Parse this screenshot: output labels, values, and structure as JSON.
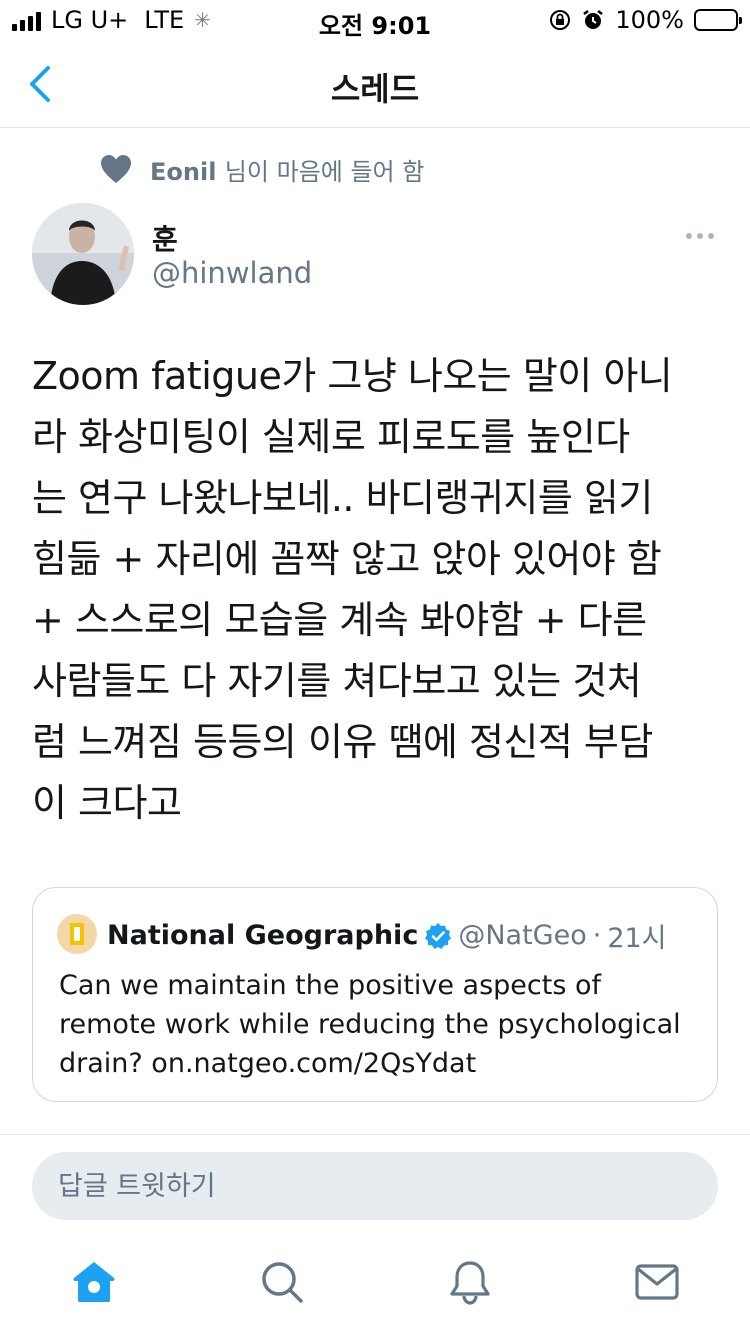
{
  "status_bar": {
    "carrier": "LG U+",
    "network": "LTE",
    "time": "오전 9:01",
    "battery": "100%"
  },
  "nav": {
    "title": "스레드"
  },
  "social_context": {
    "user": "Eonil",
    "text": "님이 마음에 들어 함",
    "icon": "heart-icon"
  },
  "author": {
    "name": "훈",
    "handle": "@hinwland"
  },
  "tweet": {
    "text": "Zoom fatigue가 그냥 나오는 말이 아니\n라 화상미팅이 실제로 피로도를 높인다\n는 연구 나왔나보네.. 바디랭귀지를 읽기\n힘듦 + 자리에 꼼짝 않고 앉아 있어야 함\n+ 스스로의 모습을 계속 봐야함 + 다른\n사람들도 다 자기를 쳐다보고 있는 것처\n럼 느껴짐 등등의 이유 땜에 정신적 부담\n이 크다고"
  },
  "quote": {
    "name": "National Geographic",
    "handle": "@NatGeo",
    "separator": "·",
    "time": "21시",
    "text": "Can we maintain the positive aspects of\nremote work while reducing the psychological\ndrain? on.natgeo.com/2QsYdat",
    "verified_color": "#1da1f2"
  },
  "reply": {
    "placeholder": "답글 트윗하기"
  },
  "tabs": [
    {
      "name": "home",
      "icon": "home-icon",
      "active": true
    },
    {
      "name": "search",
      "icon": "search-icon",
      "active": false
    },
    {
      "name": "notifications",
      "icon": "bell-icon",
      "active": false
    },
    {
      "name": "messages",
      "icon": "envelope-icon",
      "active": false
    }
  ],
  "colors": {
    "accent": "#1da1f2",
    "secondary_text": "#657786"
  }
}
